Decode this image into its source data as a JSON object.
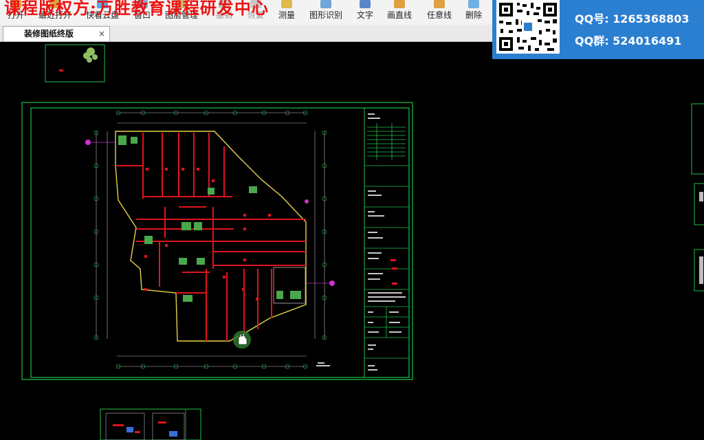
{
  "watermark": "课程版权方:万胜教育课程研发中心",
  "toolbar": {
    "items": [
      {
        "label": "打开",
        "state": "enabled"
      },
      {
        "label": "最近打开",
        "state": "enabled"
      },
      {
        "label": "快看云盘",
        "state": "enabled"
      },
      {
        "label": "窗口",
        "state": "enabled"
      },
      {
        "label": "图层管理",
        "state": "enabled"
      },
      {
        "label": "撤销",
        "state": "disabled"
      },
      {
        "label": "恢复",
        "state": "disabled"
      },
      {
        "label": "测量",
        "state": "enabled"
      },
      {
        "label": "图形识别",
        "state": "enabled"
      },
      {
        "label": "文字",
        "state": "enabled"
      },
      {
        "label": "画直线",
        "state": "enabled"
      },
      {
        "label": "任意线",
        "state": "enabled"
      },
      {
        "label": "删除",
        "state": "enabled"
      }
    ]
  },
  "tab": {
    "title": "装修图纸终版",
    "close": "×"
  },
  "contact": {
    "qq": "QQ号: 1265368803",
    "group": "QQ群: 524016491"
  },
  "colors": {
    "wall": "#e0141c",
    "frame": "#22c04a",
    "outline": "#e8d44a",
    "annotation": "#cc33cc",
    "background": "#000000"
  }
}
